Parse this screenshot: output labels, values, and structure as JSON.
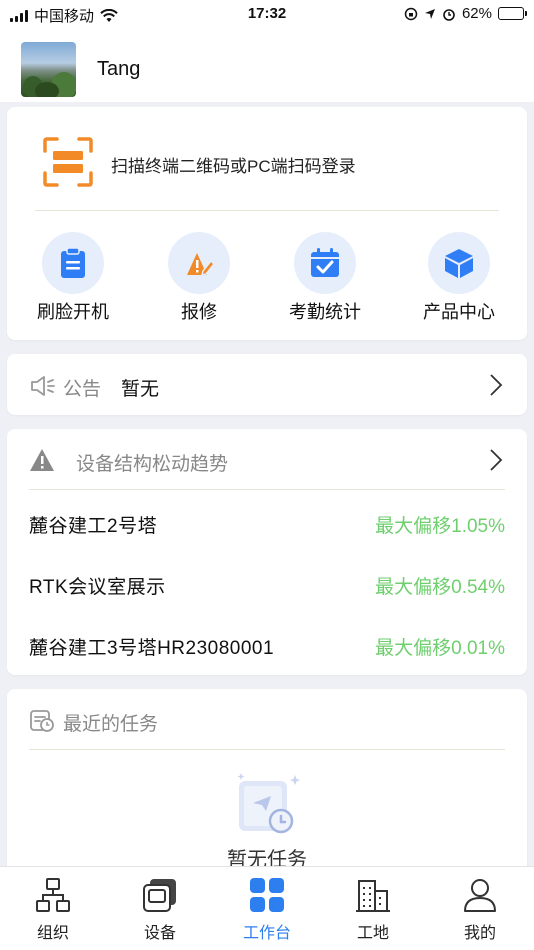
{
  "status_bar": {
    "carrier": "中国移动",
    "time": "17:32",
    "battery": "62%",
    "battery_level": 0.62
  },
  "header": {
    "username": "Tang"
  },
  "scan": {
    "text": "扫描终端二维码或PC端扫码登录"
  },
  "quick_actions": [
    {
      "label": "刷脸开机",
      "icon": "clipboard-icon",
      "color": "#2f7ef6"
    },
    {
      "label": "报修",
      "icon": "repair-pen-icon",
      "color": "#f28a28"
    },
    {
      "label": "考勤统计",
      "icon": "calendar-check-icon",
      "color": "#2f7ef6"
    },
    {
      "label": "产品中心",
      "icon": "cube-icon",
      "color": "#2f7ef6"
    }
  ],
  "notice": {
    "title": "公告",
    "value": "暂无"
  },
  "trend": {
    "title": "设备结构松动趋势",
    "rows": [
      {
        "name": "麓谷建工2号塔",
        "value": "最大偏移1.05%"
      },
      {
        "name": "RTK会议室展示",
        "value": "最大偏移0.54%"
      },
      {
        "name": "麓谷建工3号塔HR23080001",
        "value": "最大偏移0.01%"
      }
    ]
  },
  "tasks": {
    "title": "最近的任务",
    "empty": "暂无任务"
  },
  "tabs": [
    {
      "label": "组织",
      "icon": "org-chart-icon",
      "active": false
    },
    {
      "label": "设备",
      "icon": "device-icon",
      "active": false
    },
    {
      "label": "工作台",
      "icon": "workbench-grid-icon",
      "active": true
    },
    {
      "label": "工地",
      "icon": "building-icon",
      "active": false
    },
    {
      "label": "我的",
      "icon": "user-icon",
      "active": false
    }
  ],
  "colors": {
    "accent": "#2d7ff0",
    "orange": "#f28a28",
    "green": "#6fcf6f"
  }
}
